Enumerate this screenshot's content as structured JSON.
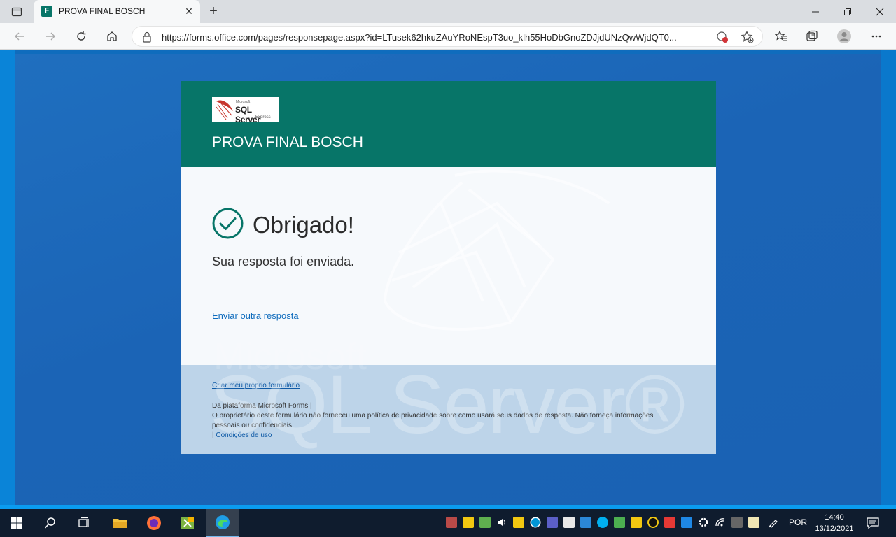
{
  "browser": {
    "tab_title": "PROVA FINAL BOSCH",
    "new_tab_glyph": "+",
    "url": "https://forms.office.com/pages/responsepage.aspx?id=LTusek62hkuZAuYRoNEspT3uo_klh55HoDbGnoZDJjdUNzQwWjdQT0..."
  },
  "form": {
    "logo_text": "SQL Server",
    "logo_small": "Microsoft",
    "logo_express": "Express",
    "title": "PROVA FINAL BOSCH",
    "thanks_heading": "Obrigado!",
    "sent_message": "Sua resposta foi enviada.",
    "another_response_link": "Enviar outra resposta",
    "accent_color": "#077568"
  },
  "footer": {
    "create_link": "Criar meu próprio formulário",
    "platform_line": "Da plataforma Microsoft Forms |",
    "privacy_text": "O proprietário deste formulário não forneceu uma política de privacidade sobre como usará seus dados de resposta. Não forneça informações pessoais ou confidenciais.",
    "terms_prefix": "|",
    "terms_link": "Condições de uso"
  },
  "watermark": {
    "microsoft": "Microsoft",
    "sql_server": "SQL Server®"
  },
  "taskbar": {
    "language": "POR",
    "time": "14:40",
    "date": "13/12/2021"
  }
}
